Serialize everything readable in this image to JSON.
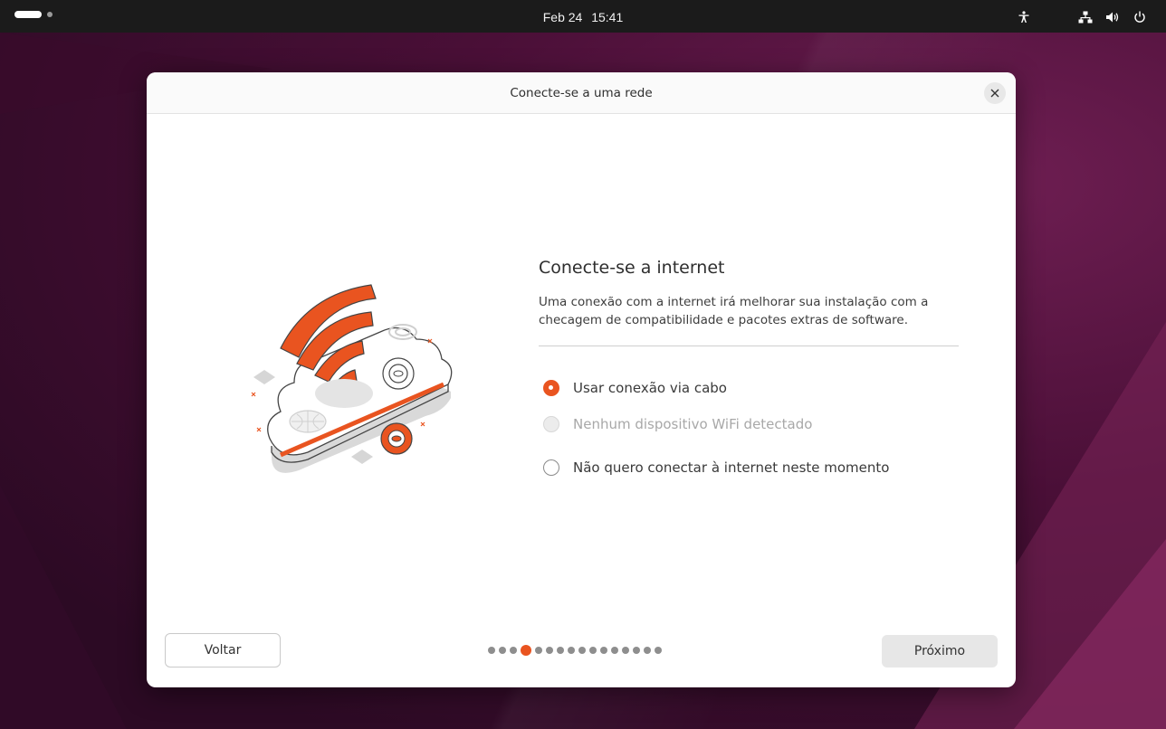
{
  "topbar": {
    "date": "Feb 24",
    "time": "15:41",
    "icons": [
      "activities-indicator",
      "accessibility-icon",
      "network-wired-icon",
      "volume-icon",
      "power-icon"
    ]
  },
  "dialog": {
    "title": "Conecte-se a uma rede",
    "close_icon": "close-icon",
    "heading": "Conecte-se a internet",
    "description_line1": "Uma conexão com a internet irá melhorar sua instalação com a",
    "description_line2": "checagem de compatibilidade e pacotes extras de software.",
    "options": [
      {
        "label": "Usar conexão via cabo",
        "checked": true,
        "disabled": false
      },
      {
        "label": "Nenhum dispositivo WiFi detectado",
        "checked": false,
        "disabled": true
      },
      {
        "label": "Não quero conectar à internet neste momento",
        "checked": false,
        "disabled": false
      }
    ],
    "back_label": "Voltar",
    "next_label": "Próximo",
    "pager": {
      "total": 16,
      "current": 4
    }
  },
  "colors": {
    "accent": "#e95420",
    "topbar": "#1b1b1b",
    "desktop": "#4a0f37"
  }
}
